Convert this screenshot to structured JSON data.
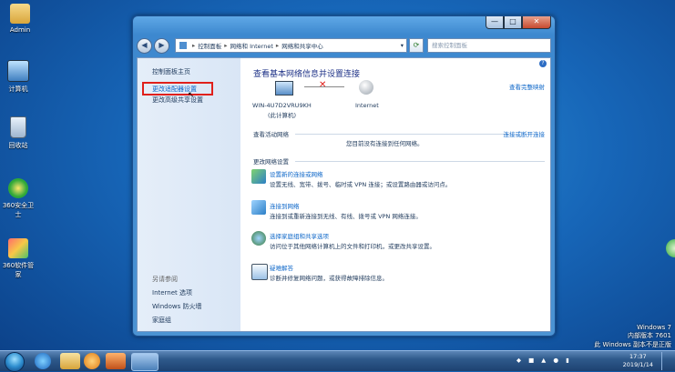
{
  "desktop": {
    "icons": [
      {
        "label": "Admin",
        "icon": "user-folder-icon"
      },
      {
        "label": "计算机",
        "icon": "computer-icon"
      },
      {
        "label": "回收站",
        "icon": "recycle-bin-icon"
      },
      {
        "label": "360安全卫士",
        "icon": "360-safe-icon"
      },
      {
        "label": "360软件管家",
        "icon": "360-software-icon"
      }
    ],
    "watermark": {
      "line1": "Windows 7",
      "line2": "内部版本 7601",
      "line3": "此 Windows 副本不是正版"
    }
  },
  "window": {
    "buttons": {
      "minimize": "—",
      "maximize": "□",
      "close": "✕"
    },
    "nav": {
      "back": "◀",
      "forward": "▶"
    },
    "address": {
      "seg1": "控制面板",
      "seg2": "网络和 Internet",
      "seg3": "网络和共享中心"
    },
    "search_placeholder": "搜索控制面板"
  },
  "sidebar": {
    "items": [
      {
        "label": "控制面板主页"
      },
      {
        "label": "更改适配器设置"
      },
      {
        "label": "更改高级共享设置"
      }
    ],
    "see_also_title": "另请参阅",
    "see_also": [
      {
        "label": "Internet 选项"
      },
      {
        "label": "Windows 防火墙"
      },
      {
        "label": "家庭组"
      }
    ]
  },
  "main": {
    "title": "查看基本网络信息并设置连接",
    "view_full_map": "查看完整映射",
    "computer_name": "WIN-4U7D2VRU9KH",
    "computer_sub": "(此计算机)",
    "internet_label": "Internet",
    "active_networks_title": "查看活动网络",
    "connect_or_disconnect": "连接或断开连接",
    "no_network_msg": "您目前没有连接到任何网络。",
    "change_settings_title": "更改网络设置",
    "tasks": [
      {
        "title": "设置新的连接或网络",
        "desc": "设置无线、宽带、拨号、临时或 VPN 连接；或设置路由器或访问点。",
        "icon": "new-connection-icon"
      },
      {
        "title": "连接到网络",
        "desc": "连接到或重新连接到无线、有线、拨号或 VPN 网络连接。",
        "icon": "connect-network-icon"
      },
      {
        "title": "选择家庭组和共享选项",
        "desc": "访问位于其他网络计算机上的文件和打印机，或更改共享设置。",
        "icon": "homegroup-icon"
      },
      {
        "title": "疑难解答",
        "desc": "诊断并修复网络问题，或获得故障排除信息。",
        "icon": "troubleshoot-icon"
      }
    ]
  },
  "taskbar": {
    "clock_time": "17:37",
    "clock_date": "2019/1/14"
  },
  "colors": {
    "highlight_box": "#e0201b",
    "link": "#0c66c8",
    "heading": "#1e3287"
  }
}
